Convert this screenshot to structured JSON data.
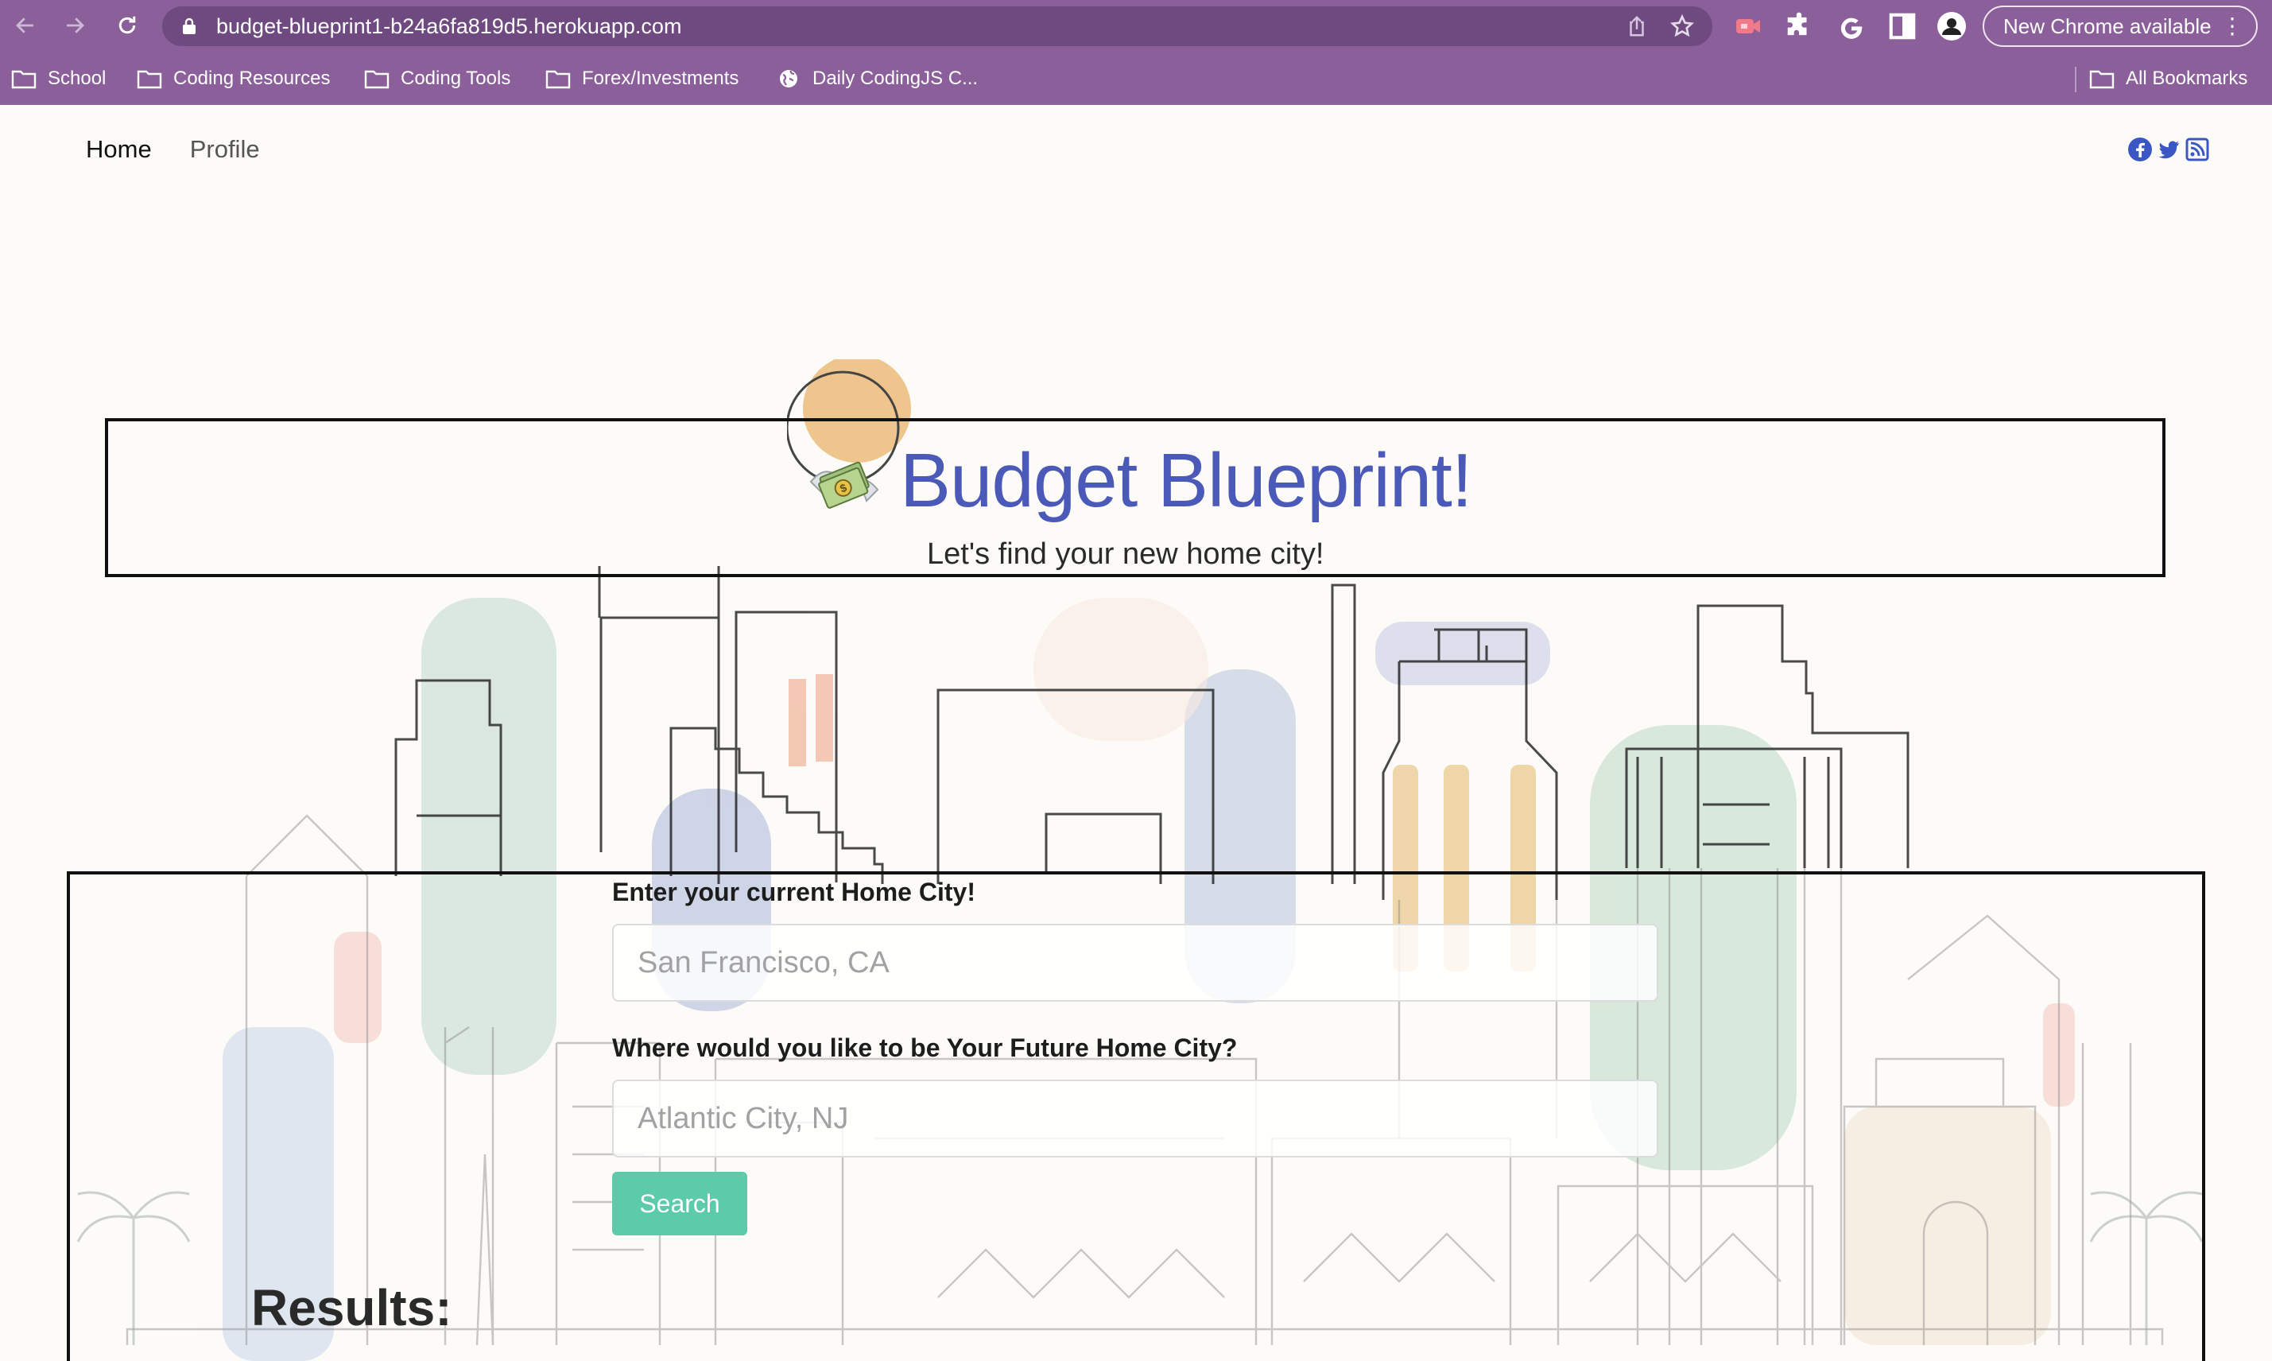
{
  "browser": {
    "url": "budget-blueprint1-b24a6fa819d5.herokuapp.com",
    "update_button": "New Chrome available",
    "update_menu": "⋮",
    "bookmarks": [
      "School",
      "Coding Resources",
      "Coding Tools",
      "Forex/Investments",
      "Daily CodingJS C...",
      "All Bookmarks"
    ],
    "colors": {
      "frame": "#8a5f9a",
      "omnibox": "#6e4a80"
    }
  },
  "nav": {
    "home": "Home",
    "profile": "Profile"
  },
  "social_icons": [
    "facebook-icon",
    "twitter-icon",
    "rss-icon"
  ],
  "hero": {
    "emoji": "💸",
    "title": "Budget Blueprint!",
    "subtitle": "Let's find your new home city!",
    "title_color": "#4b59b9"
  },
  "form": {
    "current_label": "Enter your current Home City!",
    "current_placeholder": "San Francisco, CA",
    "future_label": "Where would you like to be Your Future Home City?",
    "future_placeholder": "Atlantic City, NJ",
    "search_label": "Search",
    "button_color": "#5ccba9"
  },
  "results": {
    "heading": "Results:"
  }
}
